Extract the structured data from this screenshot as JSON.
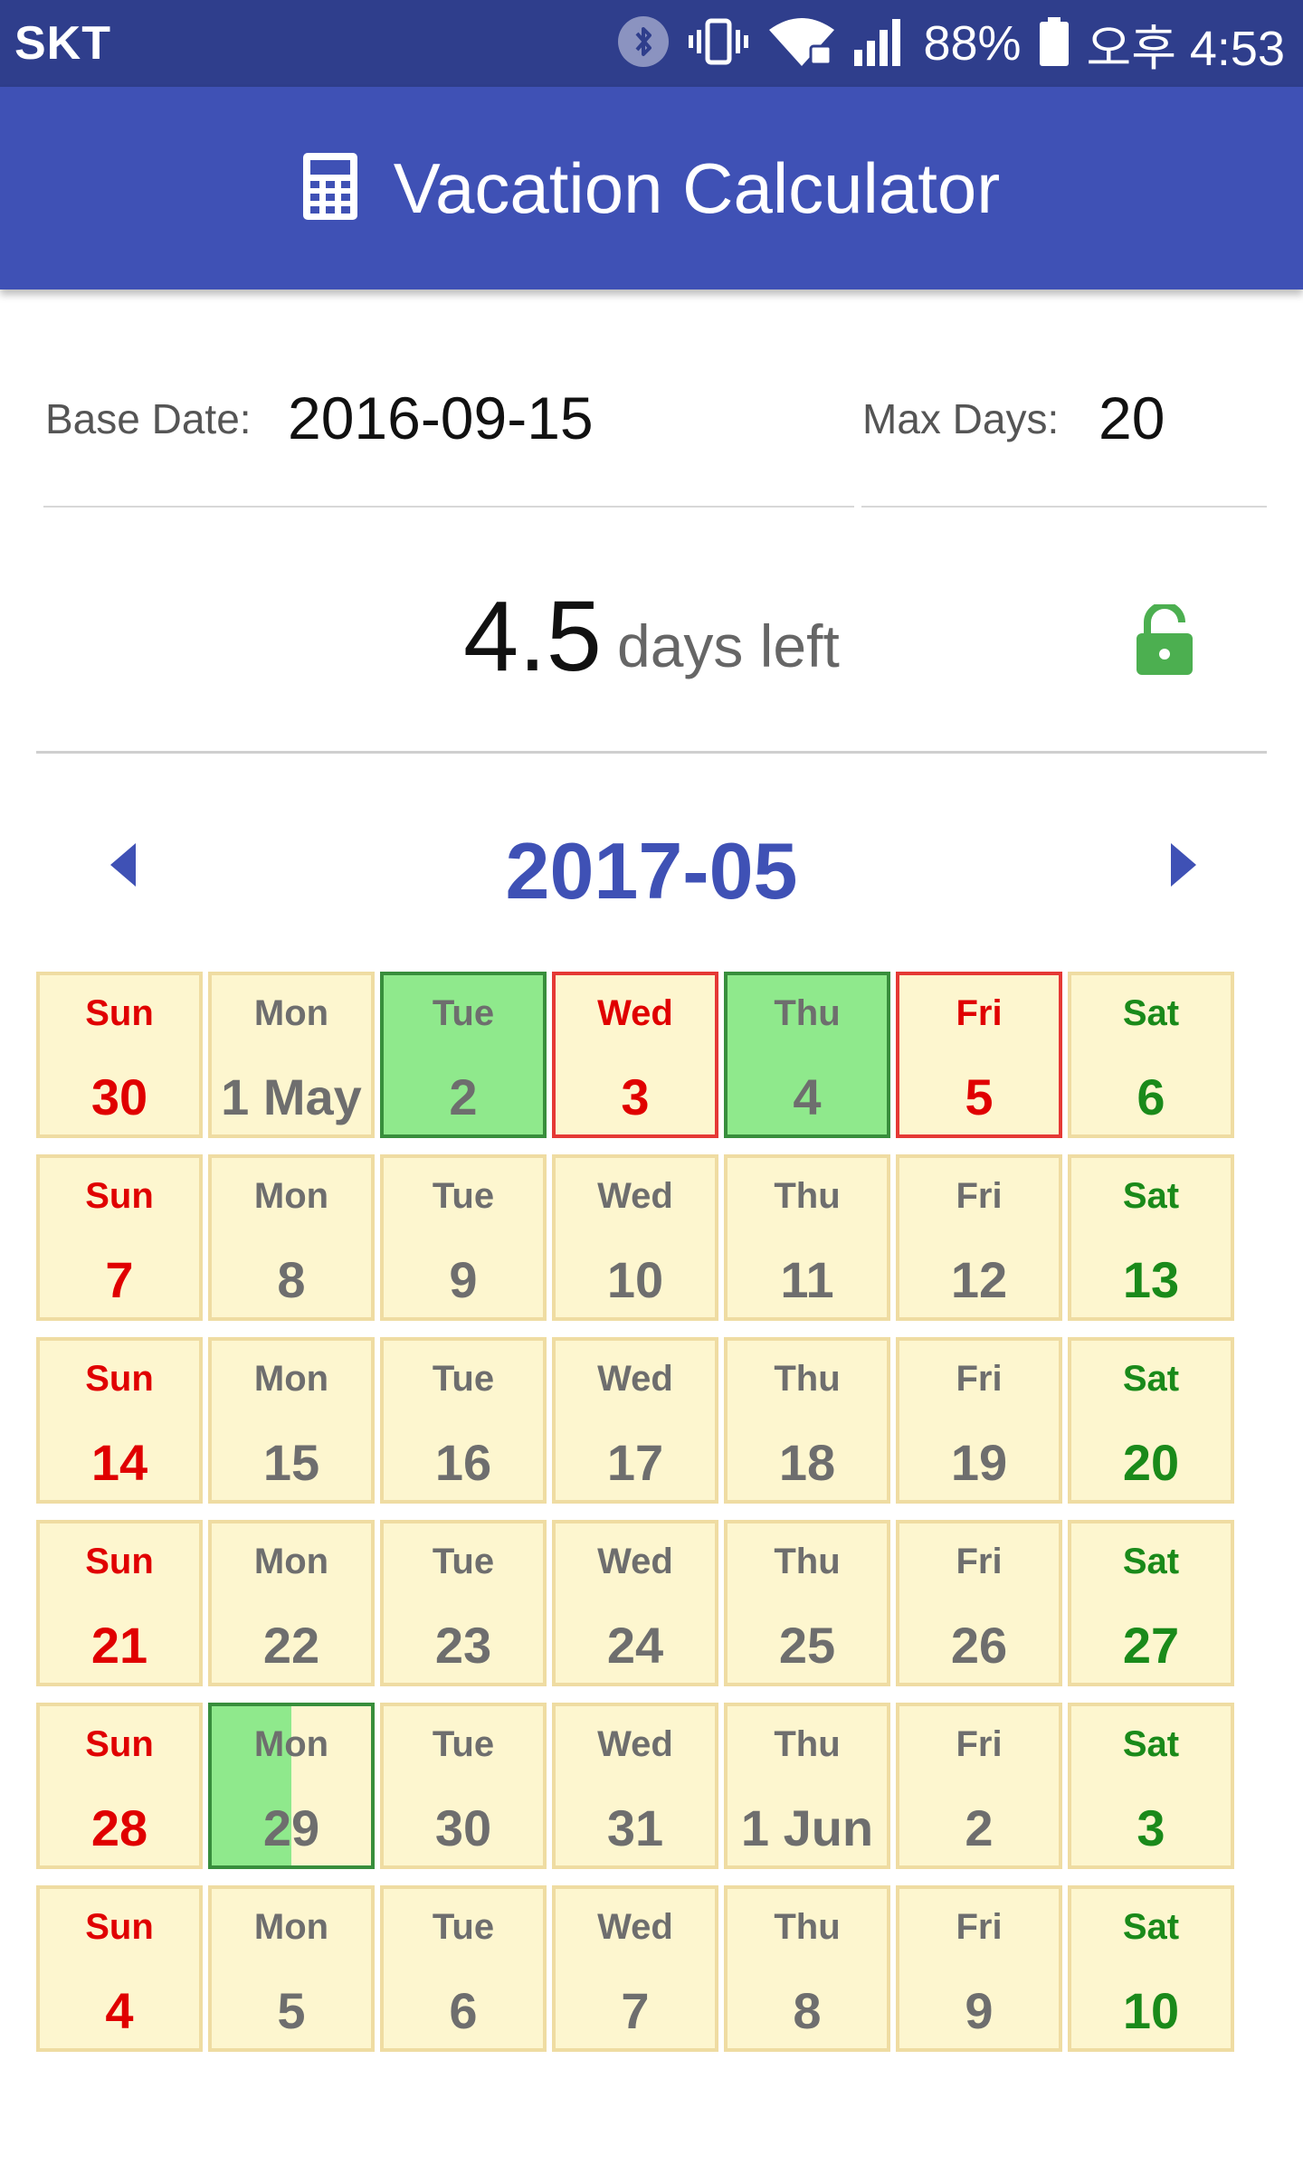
{
  "status_bar": {
    "carrier": "SKT",
    "battery": "88%",
    "time": "오후 4:53",
    "icons": [
      "bluetooth-icon",
      "vibrate-icon",
      "wifi-icon",
      "signal-icon",
      "battery-icon"
    ]
  },
  "app_bar": {
    "title": "Vacation Calculator",
    "icon": "calculator-icon"
  },
  "form": {
    "base_date_label": "Base Date:",
    "base_date_value": "2016-09-15",
    "max_days_label": "Max Days:",
    "max_days_value": "20"
  },
  "summary": {
    "days_left": "4.5",
    "days_left_text": "days left",
    "lock_state": "unlocked"
  },
  "calendar": {
    "month": "2017-05",
    "weeks": [
      [
        {
          "dow": "Sun",
          "num": "30",
          "type": "sun"
        },
        {
          "dow": "Mon",
          "num": "1 May",
          "type": ""
        },
        {
          "dow": "Tue",
          "num": "2",
          "type": "vac"
        },
        {
          "dow": "Wed",
          "num": "3",
          "type": "holiday"
        },
        {
          "dow": "Thu",
          "num": "4",
          "type": "vac"
        },
        {
          "dow": "Fri",
          "num": "5",
          "type": "holiday"
        },
        {
          "dow": "Sat",
          "num": "6",
          "type": "sat"
        }
      ],
      [
        {
          "dow": "Sun",
          "num": "7",
          "type": "sun"
        },
        {
          "dow": "Mon",
          "num": "8",
          "type": ""
        },
        {
          "dow": "Tue",
          "num": "9",
          "type": ""
        },
        {
          "dow": "Wed",
          "num": "10",
          "type": ""
        },
        {
          "dow": "Thu",
          "num": "11",
          "type": ""
        },
        {
          "dow": "Fri",
          "num": "12",
          "type": ""
        },
        {
          "dow": "Sat",
          "num": "13",
          "type": "sat"
        }
      ],
      [
        {
          "dow": "Sun",
          "num": "14",
          "type": "sun"
        },
        {
          "dow": "Mon",
          "num": "15",
          "type": ""
        },
        {
          "dow": "Tue",
          "num": "16",
          "type": ""
        },
        {
          "dow": "Wed",
          "num": "17",
          "type": ""
        },
        {
          "dow": "Thu",
          "num": "18",
          "type": ""
        },
        {
          "dow": "Fri",
          "num": "19",
          "type": ""
        },
        {
          "dow": "Sat",
          "num": "20",
          "type": "sat"
        }
      ],
      [
        {
          "dow": "Sun",
          "num": "21",
          "type": "sun"
        },
        {
          "dow": "Mon",
          "num": "22",
          "type": ""
        },
        {
          "dow": "Tue",
          "num": "23",
          "type": ""
        },
        {
          "dow": "Wed",
          "num": "24",
          "type": ""
        },
        {
          "dow": "Thu",
          "num": "25",
          "type": ""
        },
        {
          "dow": "Fri",
          "num": "26",
          "type": ""
        },
        {
          "dow": "Sat",
          "num": "27",
          "type": "sat"
        }
      ],
      [
        {
          "dow": "Sun",
          "num": "28",
          "type": "sun"
        },
        {
          "dow": "Mon",
          "num": "29",
          "type": "half"
        },
        {
          "dow": "Tue",
          "num": "30",
          "type": ""
        },
        {
          "dow": "Wed",
          "num": "31",
          "type": ""
        },
        {
          "dow": "Thu",
          "num": "1 Jun",
          "type": ""
        },
        {
          "dow": "Fri",
          "num": "2",
          "type": ""
        },
        {
          "dow": "Sat",
          "num": "3",
          "type": "sat"
        }
      ],
      [
        {
          "dow": "Sun",
          "num": "4",
          "type": "sun"
        },
        {
          "dow": "Mon",
          "num": "5",
          "type": ""
        },
        {
          "dow": "Tue",
          "num": "6",
          "type": ""
        },
        {
          "dow": "Wed",
          "num": "7",
          "type": ""
        },
        {
          "dow": "Thu",
          "num": "8",
          "type": ""
        },
        {
          "dow": "Fri",
          "num": "9",
          "type": ""
        },
        {
          "dow": "Sat",
          "num": "10",
          "type": "sat"
        }
      ]
    ]
  },
  "colors": {
    "primary": "#3f51b5",
    "status_bar": "#2f3e8c",
    "vacation_fill": "#8fe98c",
    "vacation_border": "#388e3c",
    "holiday_border": "#e53935",
    "cell_background": "#fdf6cf",
    "cell_border": "#efdca2",
    "sunday_text": "#e00000",
    "saturday_text": "#1a8a1a",
    "lock_icon": "#4caf50"
  }
}
